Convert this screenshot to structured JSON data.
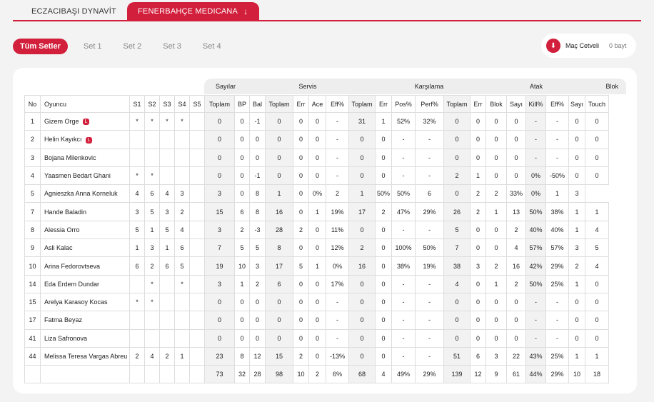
{
  "team_tabs": [
    {
      "label": "ECZACIBAŞI DYNAVİT",
      "active": false
    },
    {
      "label": "FENERBAHÇE MEDICANA",
      "active": true
    }
  ],
  "sets": [
    "Tüm Setler",
    "Set 1",
    "Set 2",
    "Set 3",
    "Set 4"
  ],
  "active_set": "Tüm Setler",
  "match_sheet": {
    "label": "Maç Cetveli",
    "size": "0 bayt",
    "icon": "download-icon"
  },
  "colors": {
    "accent": "#d21f3c"
  },
  "groups": [
    "Sayılar",
    "Servis",
    "Karşılama",
    "Atak",
    "Blok"
  ],
  "columns": [
    "No",
    "Oyuncu",
    "S1",
    "S2",
    "S3",
    "S4",
    "S5",
    "Toplam",
    "BP",
    "Bal",
    "Toplam",
    "Err",
    "Ace",
    "Eff%",
    "Toplam",
    "Err",
    "Pos%",
    "Perf%",
    "Toplam",
    "Err",
    "Blok",
    "Sayı",
    "Kill%",
    "Eff%",
    "Sayı",
    "Touch"
  ],
  "rows": [
    {
      "no": "1",
      "name": "Gizem Orge",
      "libero": "L",
      "cells": [
        "*",
        "*",
        "*",
        "*",
        "",
        "0",
        "0",
        "-1",
        "0",
        "0",
        "0",
        "-",
        "31",
        "1",
        "52%",
        "32%",
        "0",
        "0",
        "0",
        "0",
        "-",
        "-",
        "0",
        "0"
      ]
    },
    {
      "no": "2",
      "name": "Helin Kayıkcı",
      "libero": "L",
      "cells": [
        "",
        "",
        "",
        "",
        "",
        "0",
        "0",
        "0",
        "0",
        "0",
        "0",
        "-",
        "0",
        "0",
        "-",
        "-",
        "0",
        "0",
        "0",
        "0",
        "-",
        "-",
        "0",
        "0"
      ]
    },
    {
      "no": "3",
      "name": "Bojana Milenkovic",
      "libero": "",
      "cells": [
        "",
        "",
        "",
        "",
        "",
        "0",
        "0",
        "0",
        "0",
        "0",
        "0",
        "-",
        "0",
        "0",
        "-",
        "-",
        "0",
        "0",
        "0",
        "0",
        "-",
        "-",
        "0",
        "0"
      ]
    },
    {
      "no": "4",
      "name": "Yaasmen Bedart Ghani",
      "libero": "",
      "cells": [
        "*",
        "*",
        "",
        "",
        "",
        "0",
        "0",
        "-1",
        "0",
        "0",
        "0",
        "-",
        "0",
        "0",
        "-",
        "-",
        "2",
        "1",
        "0",
        "0",
        "0%",
        "-50%",
        "0",
        "0"
      ]
    },
    {
      "no": "5",
      "name": "Agnieszka Anna Korneluk",
      "libero": "",
      "cells": [
        "4",
        "6",
        "4",
        "3",
        "",
        "3",
        "0",
        "8",
        "1",
        "0",
        "0%",
        "2",
        "1",
        "50%",
        "50%",
        "6",
        "0",
        "2",
        "2",
        "33%",
        "0%",
        "1",
        "3"
      ]
    },
    {
      "no": "7",
      "name": "Hande Baladin",
      "libero": "",
      "cells": [
        "3",
        "5",
        "3",
        "2",
        "",
        "15",
        "6",
        "8",
        "16",
        "0",
        "1",
        "19%",
        "17",
        "2",
        "47%",
        "29%",
        "26",
        "2",
        "1",
        "13",
        "50%",
        "38%",
        "1",
        "1"
      ]
    },
    {
      "no": "8",
      "name": "Alessia Orro",
      "libero": "",
      "cells": [
        "5",
        "1",
        "5",
        "4",
        "",
        "3",
        "2",
        "-3",
        "28",
        "2",
        "0",
        "11%",
        "0",
        "0",
        "-",
        "-",
        "5",
        "0",
        "0",
        "2",
        "40%",
        "40%",
        "1",
        "4"
      ]
    },
    {
      "no": "9",
      "name": "Asli Kalac",
      "libero": "",
      "cells": [
        "1",
        "3",
        "1",
        "6",
        "",
        "7",
        "5",
        "5",
        "8",
        "0",
        "0",
        "12%",
        "2",
        "0",
        "100%",
        "50%",
        "7",
        "0",
        "0",
        "4",
        "57%",
        "57%",
        "3",
        "5"
      ]
    },
    {
      "no": "10",
      "name": "Arina Fedorovtseva",
      "libero": "",
      "cells": [
        "6",
        "2",
        "6",
        "5",
        "",
        "19",
        "10",
        "3",
        "17",
        "5",
        "1",
        "0%",
        "16",
        "0",
        "38%",
        "19%",
        "38",
        "3",
        "2",
        "16",
        "42%",
        "29%",
        "2",
        "4"
      ]
    },
    {
      "no": "14",
      "name": "Eda Erdem Dundar",
      "libero": "",
      "cells": [
        "",
        "*",
        "",
        "*",
        "",
        "3",
        "1",
        "2",
        "6",
        "0",
        "0",
        "17%",
        "0",
        "0",
        "-",
        "-",
        "4",
        "0",
        "1",
        "2",
        "50%",
        "25%",
        "1",
        "0"
      ]
    },
    {
      "no": "15",
      "name": "Arelya Karasoy Kocas",
      "libero": "",
      "cells": [
        "*",
        "*",
        "",
        "",
        "",
        "0",
        "0",
        "0",
        "0",
        "0",
        "0",
        "-",
        "0",
        "0",
        "-",
        "-",
        "0",
        "0",
        "0",
        "0",
        "-",
        "-",
        "0",
        "0"
      ]
    },
    {
      "no": "17",
      "name": "Fatma Beyaz",
      "libero": "",
      "cells": [
        "",
        "",
        "",
        "",
        "",
        "0",
        "0",
        "0",
        "0",
        "0",
        "0",
        "-",
        "0",
        "0",
        "-",
        "-",
        "0",
        "0",
        "0",
        "0",
        "-",
        "-",
        "0",
        "0"
      ]
    },
    {
      "no": "41",
      "name": "Liza Safronova",
      "libero": "",
      "cells": [
        "",
        "",
        "",
        "",
        "",
        "0",
        "0",
        "0",
        "0",
        "0",
        "0",
        "-",
        "0",
        "0",
        "-",
        "-",
        "0",
        "0",
        "0",
        "0",
        "-",
        "-",
        "0",
        "0"
      ]
    },
    {
      "no": "44",
      "name": "Melissa Teresa Vargas Abreu",
      "libero": "",
      "cells": [
        "2",
        "4",
        "2",
        "1",
        "",
        "23",
        "8",
        "12",
        "15",
        "2",
        "0",
        "-13%",
        "0",
        "0",
        "-",
        "-",
        "51",
        "6",
        "3",
        "22",
        "43%",
        "25%",
        "1",
        "1"
      ]
    }
  ],
  "totals": [
    "",
    "",
    "",
    "",
    "",
    "",
    "",
    "73",
    "32",
    "28",
    "98",
    "10",
    "2",
    "6%",
    "68",
    "4",
    "49%",
    "29%",
    "139",
    "12",
    "9",
    "61",
    "44%",
    "29%",
    "10",
    "18"
  ]
}
